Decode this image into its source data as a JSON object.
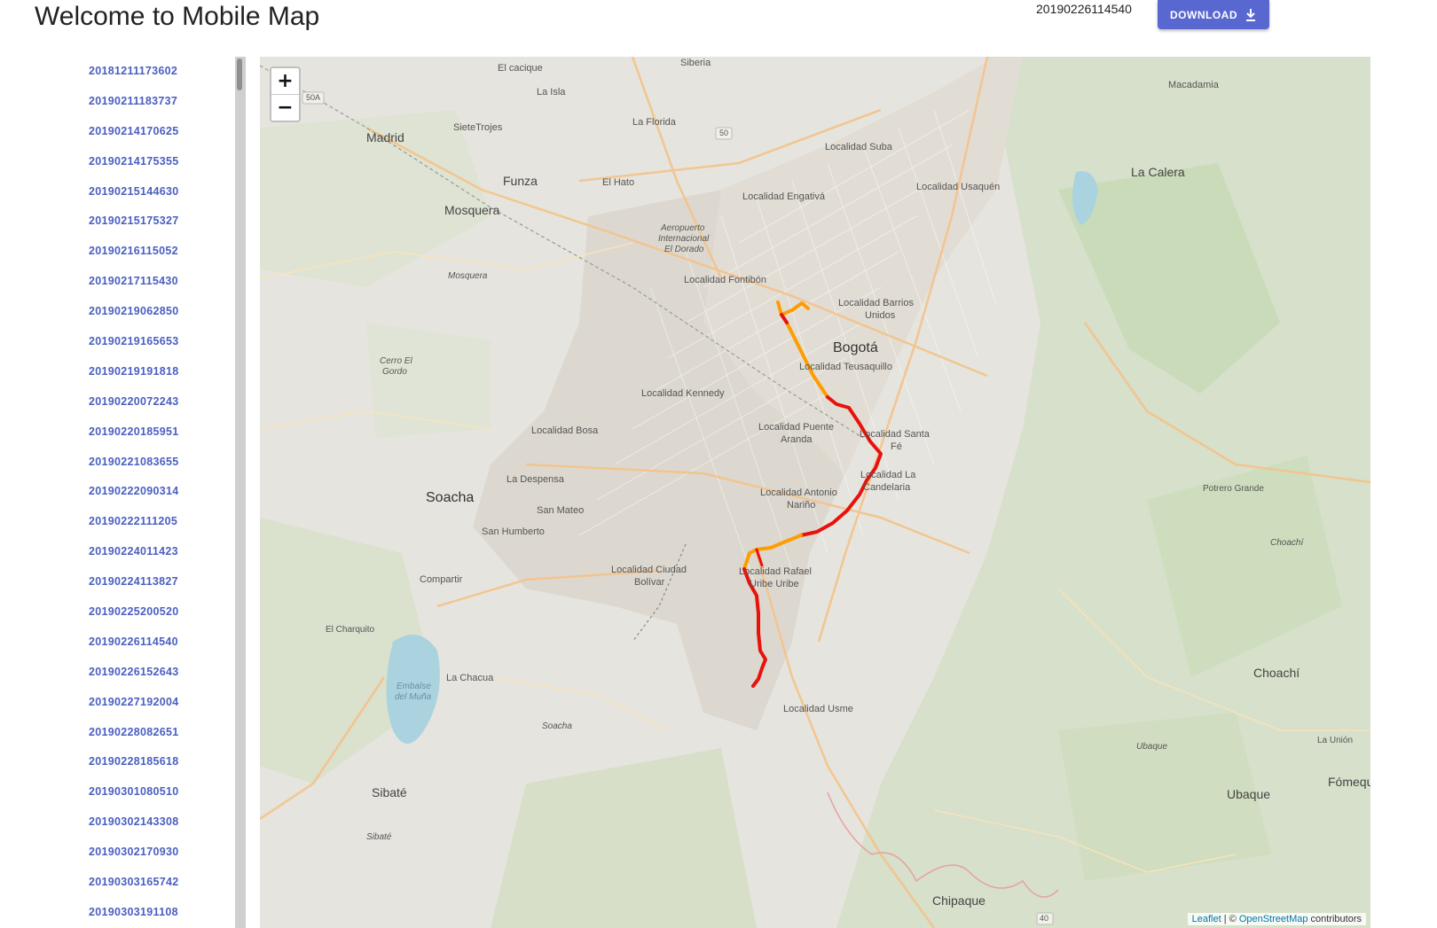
{
  "header": {
    "title": "Welcome to Mobile Map",
    "current_file": "20190226114540",
    "download_label": "DOWNLOAD",
    "download_icon": "download-icon"
  },
  "files": [
    "20181211173602",
    "20190211183737",
    "20190214170625",
    "20190214175355",
    "20190215144630",
    "20190215175327",
    "20190216115052",
    "20190217115430",
    "20190219062850",
    "20190219165653",
    "20190219191818",
    "20190220072243",
    "20190220185951",
    "20190221083655",
    "20190222090314",
    "20190222111205",
    "20190224011423",
    "20190224113827",
    "20190225200520",
    "20190226114540",
    "20190226152643",
    "20190227192004",
    "20190228082651",
    "20190228185618",
    "20190301080510",
    "20190302143308",
    "20190302170930",
    "20190303165742",
    "20190303191108"
  ],
  "map": {
    "zoom_in": "+",
    "zoom_out": "−",
    "attribution": {
      "leaflet": "Leaflet",
      "sep": " | © ",
      "osm": "OpenStreetMap",
      "contributors": " contributors"
    },
    "labels": {
      "cacique": "El cacique",
      "siberia": "Siberia",
      "la_isla": "La Isla",
      "madrid": "Madrid",
      "sietetrojes": "SieteTrojes",
      "la_florida": "La Florida",
      "suba": "Localidad Suba",
      "macadamia": "Macadamia",
      "funza": "Funza",
      "el_hato": "El Hato",
      "engativa": "Localidad Engativá",
      "usaquen": "Localidad Usaquén",
      "la_calera": "La Calera",
      "mosquera": "Mosquera",
      "aeropuerto": "Aeropuerto",
      "internacional": "Internacional",
      "el_dorado": "El Dorado",
      "mosquera_small": "Mosquera",
      "fontibon": "Localidad Fontibón",
      "barrios_unidos": "Localidad Barrios",
      "barrios_unidos2": "Unidos",
      "bogota": "Bogotá",
      "teusaquillo": "Localidad Teusaquillo",
      "kennedy": "Localidad Kennedy",
      "cerro_gordo": "Cerro El",
      "cerro_gordo2": "Gordo",
      "bosa": "Localidad Bosa",
      "puente_aranda": "Localidad Puente",
      "puente_aranda2": "Aranda",
      "santa_fe": "Localidad Santa",
      "santa_fe2": "Fé",
      "candelaria": "Localidad La",
      "candelaria2": "Candelaria",
      "soacha": "Soacha",
      "la_despensa": "La Despensa",
      "antonio_narino": "Localidad Antonio",
      "antonio_narino2": "Nariño",
      "potrero_grande": "Potrero Grande",
      "san_mateo": "San Mateo",
      "san_humberto": "San Humberto",
      "ciudad_bolivar": "Localidad Ciudad",
      "ciudad_bolivar2": "Bolívar",
      "rafael_uribe": "Localidad Rafael",
      "rafael_uribe2": "Uribe Uribe",
      "compartir": "Compartir",
      "el_charquito": "El Charquito",
      "la_chacua": "La Chacua",
      "embalse": "Embalse",
      "del_muna": "del Muña",
      "usme": "Localidad Usme",
      "choachi": "Choachí",
      "choachi_small": "Choachí",
      "soacha_small": "Soacha",
      "ubaque_small": "Ubaque",
      "la_union": "La Unión",
      "sibate": "Sibaté",
      "ubaque": "Ubaque",
      "fomeque": "Fómequ",
      "sibate_small": "Sibaté",
      "chipaque": "Chipaque",
      "road_50a": "50A",
      "road_50": "50",
      "road_40": "40"
    },
    "route_colors": {
      "fast": "#ff9c00",
      "slow": "#e8120c"
    }
  }
}
